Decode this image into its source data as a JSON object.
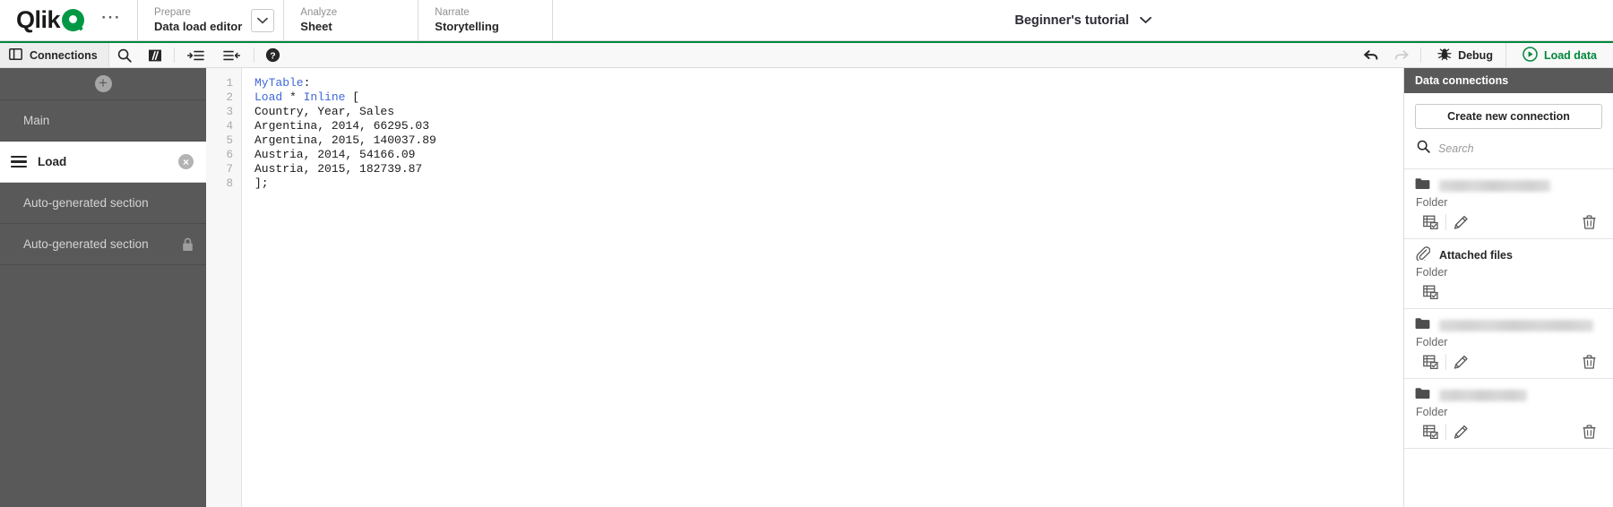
{
  "header": {
    "logo_text": "Qlik",
    "logo_icon": "qlik-logo-mark",
    "more_icon": "ellipsis-icon",
    "nav_tabs": [
      {
        "eyebrow": "Prepare",
        "title": "Data load editor",
        "icon": "chevron-down-icon"
      },
      {
        "eyebrow": "Analyze",
        "title": "Sheet"
      },
      {
        "eyebrow": "Narrate",
        "title": "Storytelling"
      }
    ],
    "app_title": "Beginner's tutorial",
    "app_title_icon": "chevron-down-icon"
  },
  "toolbar": {
    "connections_label": "Connections",
    "connections_icon": "panel-icon",
    "search_icon": "search-icon",
    "comment_icon": "comment-slashes-icon",
    "indent_icon": "indent-increase-icon",
    "outdent_icon": "indent-decrease-icon",
    "help_icon": "help-circle-icon",
    "undo_icon": "undo-arrow-icon",
    "redo_icon": "redo-arrow-icon",
    "debug_label": "Debug",
    "debug_icon": "bug-icon",
    "load_label": "Load data",
    "load_icon": "play-circle-icon",
    "accent_color": "#00873d"
  },
  "sidebar": {
    "add_section_icon": "plus-circle-icon",
    "sections": [
      {
        "label": "Main",
        "active": false,
        "locked": false,
        "closable": false
      },
      {
        "label": "Load",
        "active": true,
        "locked": false,
        "closable": true
      },
      {
        "label": "Auto-generated section",
        "active": false,
        "locked": false,
        "closable": false
      },
      {
        "label": "Auto-generated section",
        "active": false,
        "locked": true,
        "closable": false
      }
    ]
  },
  "editor": {
    "line_numbers": [
      "1",
      "2",
      "3",
      "4",
      "5",
      "6",
      "7",
      "8"
    ],
    "lines": [
      [
        {
          "t": "MyTable",
          "c": "tbl"
        },
        {
          "t": ":",
          "c": ""
        }
      ],
      [
        {
          "t": "Load",
          "c": "kw"
        },
        {
          "t": " * ",
          "c": ""
        },
        {
          "t": "Inline",
          "c": "kw"
        },
        {
          "t": " [",
          "c": ""
        }
      ],
      [
        {
          "t": "Country, Year, Sales",
          "c": ""
        }
      ],
      [
        {
          "t": "Argentina, 2014, 66295.03",
          "c": ""
        }
      ],
      [
        {
          "t": "Argentina, 2015, 140037.89",
          "c": ""
        }
      ],
      [
        {
          "t": "Austria, 2014, 54166.09",
          "c": ""
        }
      ],
      [
        {
          "t": "Austria, 2015, 182739.87",
          "c": ""
        }
      ],
      [
        {
          "t": "];",
          "c": ""
        }
      ]
    ]
  },
  "data_panel": {
    "title": "Data connections",
    "create_label": "Create new connection",
    "search_placeholder": "Search",
    "search_value": "",
    "search_icon": "search-icon",
    "connections": [
      {
        "icon": "folder-icon",
        "name_redacted": true,
        "name": "",
        "name_width": 124,
        "type": "Folder",
        "actions": [
          "select-data-icon",
          "edit-pencil-icon",
          "delete-trash-icon"
        ]
      },
      {
        "icon": "paperclip-icon",
        "name_redacted": false,
        "name": "Attached files",
        "name_width": 0,
        "type": "Folder",
        "actions": [
          "select-data-icon"
        ]
      },
      {
        "icon": "folder-icon",
        "name_redacted": true,
        "name": "",
        "name_width": 172,
        "type": "Folder",
        "actions": [
          "select-data-icon",
          "edit-pencil-icon",
          "delete-trash-icon"
        ]
      },
      {
        "icon": "folder-icon",
        "name_redacted": true,
        "name": "",
        "name_width": 98,
        "type": "Folder",
        "actions": [
          "select-data-icon",
          "edit-pencil-icon",
          "delete-trash-icon"
        ]
      }
    ]
  }
}
